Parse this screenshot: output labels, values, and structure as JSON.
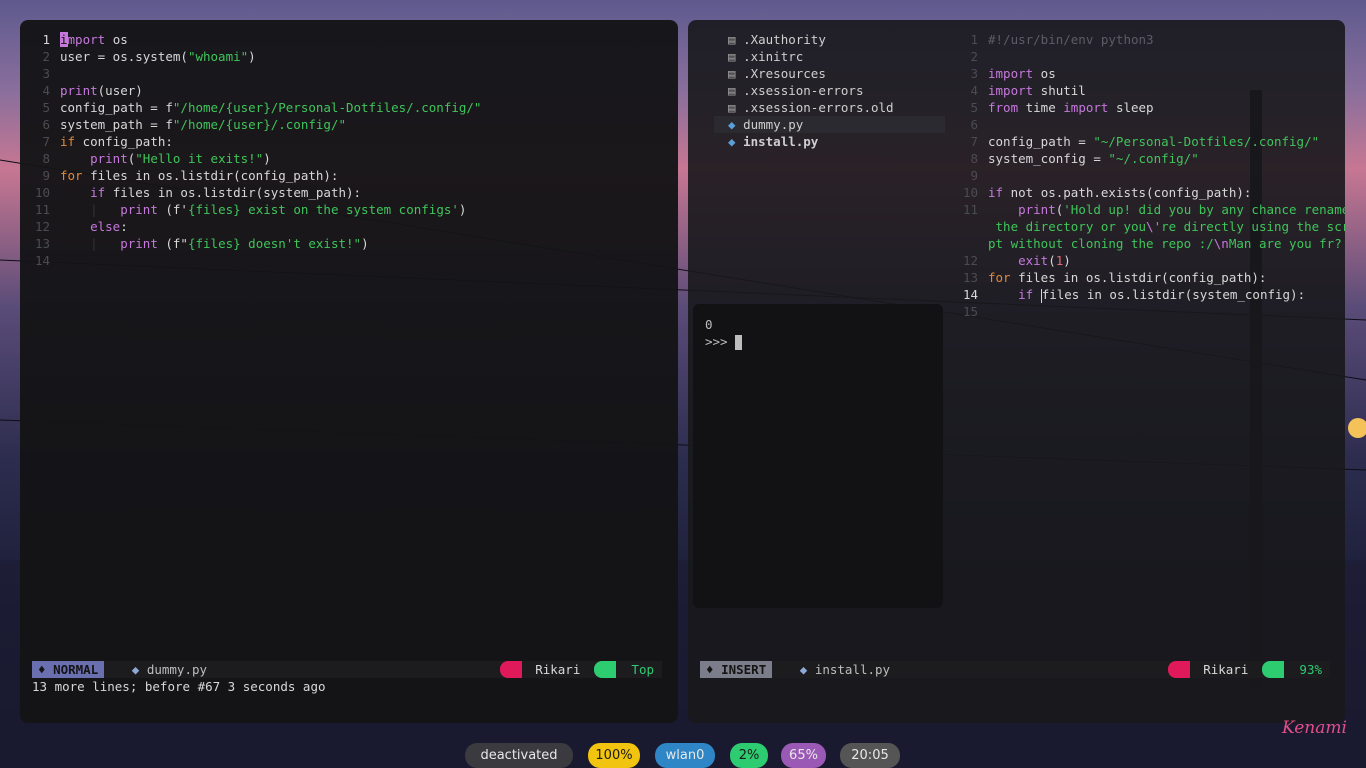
{
  "colors": {
    "accent_purple": "#c678dd",
    "string_green": "#3fc55a",
    "keyword_orange": "#e2893a",
    "number_red": "#e06c75",
    "badge_yellow": "#f1c40f",
    "badge_blue": "#2f86c6",
    "badge_green": "#2ecc71",
    "badge_purple": "#9b59b6",
    "badge_gray": "#555"
  },
  "left_editor": {
    "lines": [
      {
        "n": "1",
        "parts": [
          [
            "cur",
            "i"
          ],
          [
            "kw",
            "mport"
          ],
          [
            "txt",
            " os"
          ]
        ]
      },
      {
        "n": "2",
        "parts": [
          [
            "txt",
            "user = os.system("
          ],
          [
            "str",
            "\"whoami\""
          ],
          [
            "txt",
            ")"
          ]
        ]
      },
      {
        "n": "3",
        "parts": []
      },
      {
        "n": "4",
        "parts": [
          [
            "kw",
            "print"
          ],
          [
            "txt",
            "(user)"
          ]
        ]
      },
      {
        "n": "5",
        "parts": [
          [
            "txt",
            "config_path = f"
          ],
          [
            "str",
            "\"/home/{user}/Personal-Dotfiles/.config/\""
          ]
        ]
      },
      {
        "n": "6",
        "parts": [
          [
            "txt",
            "system_path = f"
          ],
          [
            "str",
            "\"/home/{user}/.config/\""
          ]
        ]
      },
      {
        "n": "7",
        "parts": [
          [
            "kwo",
            "if"
          ],
          [
            "txt",
            " config_path:"
          ]
        ]
      },
      {
        "n": "8",
        "parts": [
          [
            "txt",
            "    "
          ],
          [
            "kw",
            "print"
          ],
          [
            "txt",
            "("
          ],
          [
            "str",
            "\"Hello it exits!\""
          ],
          [
            "txt",
            ")"
          ]
        ]
      },
      {
        "n": "9",
        "parts": [
          [
            "kwo",
            "for"
          ],
          [
            "txt",
            " files in os.listdir(config_path):"
          ]
        ]
      },
      {
        "n": "10",
        "parts": [
          [
            "txt",
            "    "
          ],
          [
            "kw",
            "if"
          ],
          [
            "txt",
            " files in os.listdir(system_path):"
          ]
        ]
      },
      {
        "n": "11",
        "parts": [
          [
            "txt",
            "    "
          ],
          [
            "ig",
            "|"
          ],
          [
            "txt",
            "   "
          ],
          [
            "kw",
            "print"
          ],
          [
            "txt",
            " (f'"
          ],
          [
            "str",
            "{files} exist on the system configs'"
          ],
          [
            "txt",
            ")"
          ]
        ]
      },
      {
        "n": "12",
        "parts": [
          [
            "txt",
            "    "
          ],
          [
            "kw",
            "else"
          ],
          [
            "txt",
            ":"
          ]
        ]
      },
      {
        "n": "13",
        "parts": [
          [
            "txt",
            "    "
          ],
          [
            "ig",
            "|"
          ],
          [
            "txt",
            "   "
          ],
          [
            "kw",
            "print"
          ],
          [
            "txt",
            " (f\""
          ],
          [
            "str",
            "{files} doesn't exist!\""
          ],
          [
            "txt",
            ")"
          ]
        ]
      },
      {
        "n": "14",
        "parts": []
      }
    ],
    "status": {
      "mode": "NORMAL",
      "file": "dummy.py",
      "user": "Rikari",
      "position": "Top"
    },
    "cmdline": "13 more lines; before #67  3 seconds ago"
  },
  "file_tree": {
    "items": [
      {
        "icon": "file-icon",
        "name": ".Xauthority"
      },
      {
        "icon": "file-icon",
        "name": ".xinitrc"
      },
      {
        "icon": "file-icon",
        "name": ".Xresources"
      },
      {
        "icon": "file-icon",
        "name": ".xsession-errors"
      },
      {
        "icon": "file-icon",
        "name": ".xsession-errors.old"
      },
      {
        "icon": "python-icon",
        "name": "dummy.py",
        "selected": true
      },
      {
        "icon": "python-icon",
        "name": "install.py",
        "bold": true
      }
    ]
  },
  "terminal": {
    "line1": "0",
    "prompt": ">>> "
  },
  "right_editor": {
    "lines": [
      {
        "n": "1",
        "parts": [
          [
            "cmt",
            "#!/usr/bin/env python3"
          ]
        ]
      },
      {
        "n": "2",
        "parts": []
      },
      {
        "n": "3",
        "parts": [
          [
            "kw",
            "import"
          ],
          [
            "txt",
            " os"
          ]
        ]
      },
      {
        "n": "4",
        "parts": [
          [
            "kw",
            "import"
          ],
          [
            "txt",
            " shutil"
          ]
        ]
      },
      {
        "n": "5",
        "parts": [
          [
            "kw",
            "from"
          ],
          [
            "txt",
            " time "
          ],
          [
            "kw",
            "import"
          ],
          [
            "txt",
            " sleep"
          ]
        ]
      },
      {
        "n": "6",
        "parts": []
      },
      {
        "n": "7",
        "parts": [
          [
            "txt",
            "config_path = "
          ],
          [
            "str",
            "\"~/Personal-Dotfiles/.config/\""
          ]
        ]
      },
      {
        "n": "8",
        "parts": [
          [
            "txt",
            "system_config = "
          ],
          [
            "str",
            "\"~/.config/\""
          ]
        ]
      },
      {
        "n": "9",
        "parts": []
      },
      {
        "n": "10",
        "parts": [
          [
            "kw",
            "if"
          ],
          [
            "txt",
            " not os.path.exists(config_path):"
          ]
        ]
      },
      {
        "n": "11",
        "parts": [
          [
            "txt",
            "    "
          ],
          [
            "kw",
            "print"
          ],
          [
            "txt",
            "("
          ],
          [
            "str",
            "'Hold up! did you by any chance renamed"
          ]
        ]
      },
      {
        "n": "",
        "parts": [
          [
            "str",
            " the directory or you"
          ],
          [
            "kw",
            "\\'"
          ],
          [
            "str",
            "re directly using the scri"
          ]
        ]
      },
      {
        "n": "",
        "parts": [
          [
            "str",
            "pt without cloning the repo :/"
          ],
          [
            "kw",
            "\\n"
          ],
          [
            "str",
            "Man are you fr?'"
          ],
          [
            "txt",
            ")"
          ]
        ]
      },
      {
        "n": "12",
        "parts": [
          [
            "txt",
            "    "
          ],
          [
            "kw",
            "exit"
          ],
          [
            "txt",
            "("
          ],
          [
            "num",
            "1"
          ],
          [
            "txt",
            ")"
          ]
        ]
      },
      {
        "n": "13",
        "parts": [
          [
            "kwo",
            "for"
          ],
          [
            "txt",
            " files in os.listdir(config_path):"
          ]
        ]
      },
      {
        "n": "14",
        "cur": true,
        "parts": [
          [
            "txt",
            "    "
          ],
          [
            "kw",
            "if"
          ],
          [
            "txt",
            " "
          ],
          [
            "bar",
            ""
          ],
          [
            "txt",
            "files in os.listdir(system_config):"
          ]
        ]
      },
      {
        "n": "15",
        "parts": []
      }
    ],
    "status": {
      "mode": "INSERT",
      "file": "install.py",
      "user": "Rikari",
      "position": "93%"
    }
  },
  "taskbar": {
    "vpn": "deactivated",
    "brightness": "100%",
    "network": "wlan0",
    "cpu": "2%",
    "volume": "65%",
    "clock": "20:05"
  },
  "signature": "Kenami"
}
